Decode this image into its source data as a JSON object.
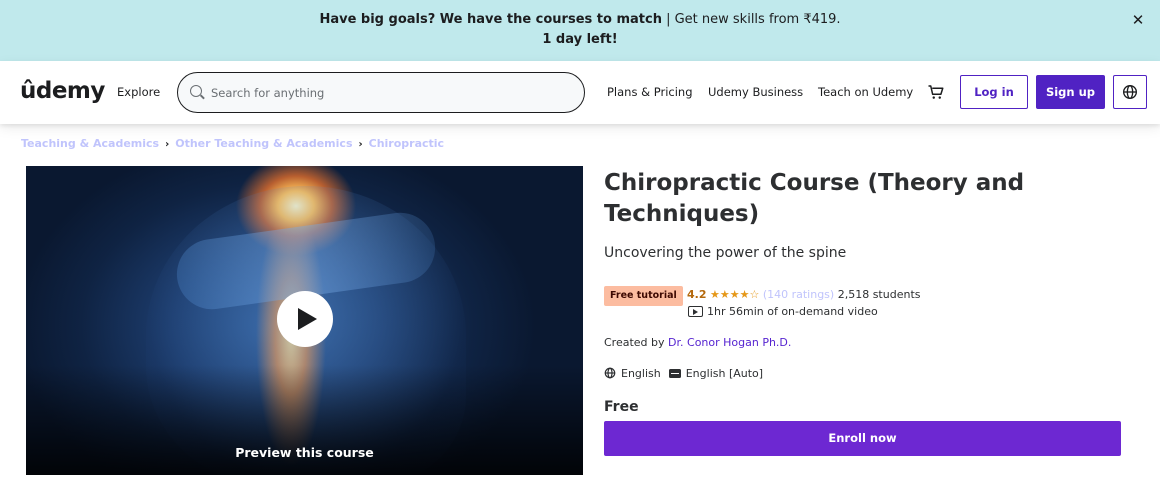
{
  "banner": {
    "bold_text": "Have big goals? We have the courses to match",
    "normal_text": " | Get new skills from ₹419.",
    "countdown": "1 day left!",
    "close_glyph": "✕"
  },
  "header": {
    "logo": "ûdemy",
    "explore": "Explore",
    "search_placeholder": "Search for anything",
    "plans_pricing": "Plans & Pricing",
    "udemy_business": "Udemy Business",
    "teach": "Teach on Udemy",
    "login": "Log in",
    "signup": "Sign up"
  },
  "breadcrumb": {
    "items": [
      "Teaching & Academics",
      "Other Teaching & Academics",
      "Chiropractic"
    ],
    "separator": "›"
  },
  "preview": {
    "label": "Preview this course"
  },
  "course": {
    "title": "Chiropractic Course (Theory and Techniques)",
    "subtitle": "Uncovering the power of the spine",
    "badge": "Free tutorial",
    "rating": "4.2",
    "stars": "★★★★☆",
    "ratings_count": "(140 ratings)",
    "students": "2,518 students",
    "video_length": "1hr 56min of on-demand video",
    "created_by_label": "Created by ",
    "instructor": "Dr. Conor Hogan Ph.D.",
    "language": "English",
    "captions": "English [Auto]",
    "price": "Free",
    "enroll": "Enroll now"
  },
  "colors": {
    "banner_bg": "#c0e9ec",
    "brand_purple": "#5022c3",
    "enroll_purple": "#6d28d2",
    "badge_bg": "#fcbca0",
    "rating_orange": "#b4690e",
    "star_color": "#e59819"
  }
}
